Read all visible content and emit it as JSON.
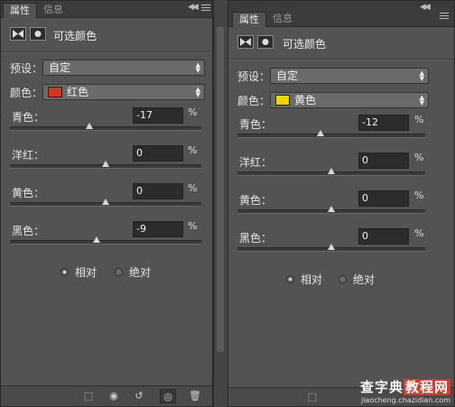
{
  "panel_left": {
    "tabs": [
      {
        "label": "属性",
        "active": true
      },
      {
        "label": "信息",
        "active": false
      }
    ],
    "title": "可选颜色",
    "preset": {
      "label": "预设：",
      "value": "自定"
    },
    "colors": {
      "label": "颜色：",
      "value": "红色",
      "swatch": "#d0391c"
    },
    "sliders": [
      {
        "label": "青色：",
        "value": "-17",
        "unit": "%",
        "level": -17
      },
      {
        "label": "洋红：",
        "value": "0",
        "unit": "%",
        "level": 0
      },
      {
        "label": "黄色：",
        "value": "0",
        "unit": "%",
        "level": 0
      },
      {
        "label": "黑色：",
        "value": "-9",
        "unit": "%",
        "level": -9
      }
    ],
    "method": {
      "relative": "相对",
      "absolute": "绝对",
      "selected": "relative"
    }
  },
  "panel_right": {
    "tabs": [
      {
        "label": "属性",
        "active": true
      },
      {
        "label": "信息",
        "active": false
      }
    ],
    "title": "可选颜色",
    "preset": {
      "label": "预设：",
      "value": "自定"
    },
    "colors": {
      "label": "颜色：",
      "value": "黄色",
      "swatch": "#f2d400"
    },
    "sliders": [
      {
        "label": "青色：",
        "value": "-12",
        "unit": "%",
        "level": -12
      },
      {
        "label": "洋红：",
        "value": "0",
        "unit": "%",
        "level": 0
      },
      {
        "label": "黄色：",
        "value": "0",
        "unit": "%",
        "level": 0
      },
      {
        "label": "黑色：",
        "value": "0",
        "unit": "%",
        "level": 0
      }
    ],
    "method": {
      "relative": "相对",
      "absolute": "绝对",
      "selected": "relative"
    }
  },
  "watermark": {
    "brand": "查字典",
    "highlight": "教程网",
    "url": "jiaocheng.chazidian.com"
  },
  "colors": {
    "panel_bg": "#535353",
    "tab_bg": "#3c3c3c",
    "field_bg": "#2c2c2c"
  }
}
